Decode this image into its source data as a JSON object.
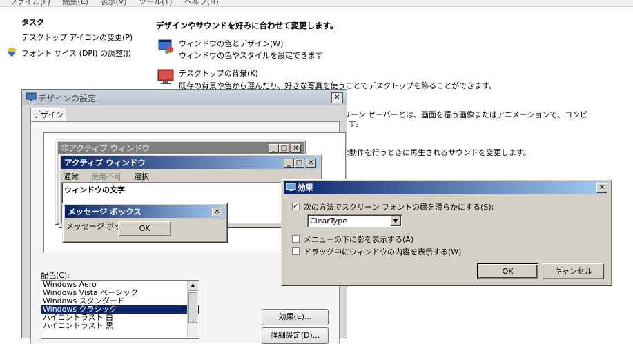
{
  "menubar": {
    "items": [
      "ファイル(F)",
      "編集(E)",
      "表示(V)",
      "ツール(T)",
      "ヘルプ(H)"
    ]
  },
  "tasks": {
    "heading": "タスク",
    "items": [
      "デスクトップ アイコンの変更(P)",
      "フォント サイズ (DPI) の調整(J)"
    ]
  },
  "main": {
    "heading": "デザインやサウンドを好みに合わせて変更します。",
    "items": [
      {
        "title": "ウィンドウの色とデザイン(W)",
        "desc": "ウィンドウの色やスタイルを設定できます"
      },
      {
        "title": "デスクトップの背景(K)",
        "desc": "既存の背景や色から選んだり、好きな写真を使うことでデスクトップを飾ることができます。"
      }
    ],
    "partial_texts": [
      "リーン セーバーとは、画面を覆う画像またはアニメーションで、コンピ",
      "す。",
      "な動作を行うときに再生されるサウンドを変更します。"
    ]
  },
  "appearance_dialog": {
    "title": "デザインの設定",
    "tab": "デザイン",
    "close": "✕",
    "preview": {
      "inactive_title": "非アクティブ ウィンドウ",
      "active_title": "アクティブ ウィンドウ",
      "menu": [
        "通常",
        "使用不可",
        "選択"
      ],
      "window_text": "ウィンドウの文字",
      "msgbox_title": "メッセージ ボックス",
      "msgbox_text": "メッセージ ボックス",
      "ok": "OK"
    },
    "color_scheme_label": "配色(C):",
    "color_schemes": [
      "Windows Aero",
      "Windows Vista ベーシック",
      "Windows スタンダード",
      "Windows クラシック",
      "ハイコントラスト 白",
      "ハイコントラスト 黒"
    ],
    "selected_scheme": "Windows クラシック",
    "effects_button": "効果(E)...",
    "advanced_button": "詳細設定(D)..."
  },
  "effects_dialog": {
    "title": "効果",
    "close": "✕",
    "options": [
      {
        "label": "次の方法でスクリーン フォントの縁を滑らかにする(S):",
        "checked": true
      },
      {
        "label": "メニューの下に影を表示する(A)",
        "checked": false
      },
      {
        "label": "ドラッグ中にウィンドウの内容を表示する(W)",
        "checked": false
      }
    ],
    "smoothing_value": "ClearType",
    "ok": "OK",
    "cancel": "キャンセル"
  },
  "colors": {
    "classic_face": "#d4d0c8",
    "active_title_start": "#0a246a",
    "active_title_end": "#a6caf0",
    "inactive_title": "#808080",
    "selection": "#0a246a"
  }
}
